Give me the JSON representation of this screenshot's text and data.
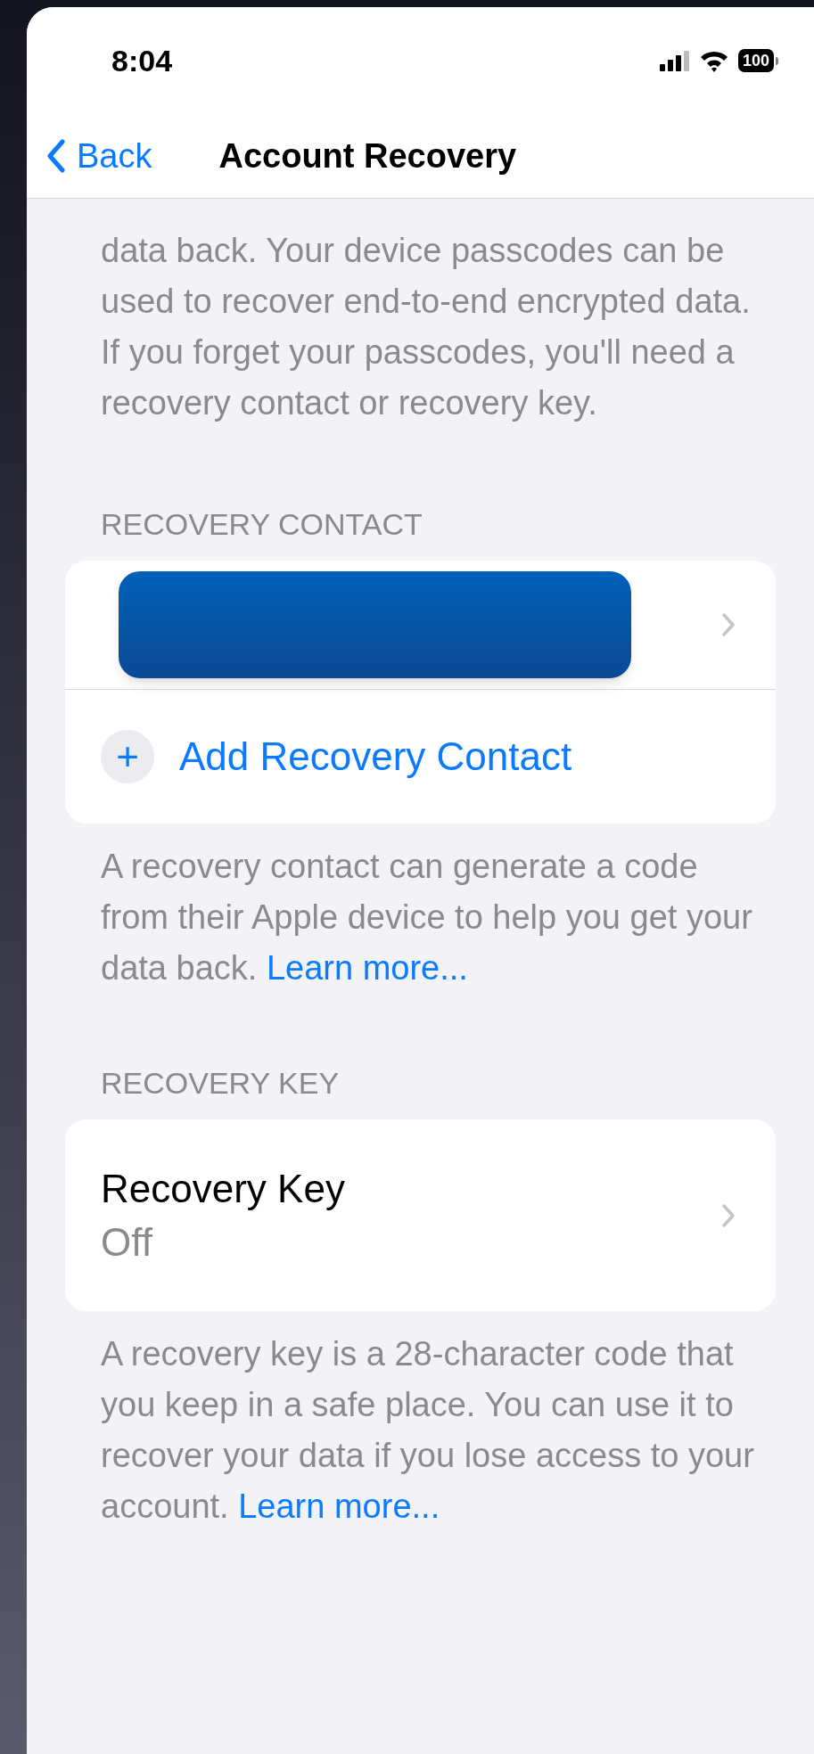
{
  "status_bar": {
    "time": "8:04",
    "battery": "100"
  },
  "nav": {
    "back": "Back",
    "title": "Account Recovery"
  },
  "intro": "data back. Your device passcodes can be used to recover end-to-end encrypted data. If you forget your passcodes, you'll need a recovery contact or recovery key.",
  "sections": [
    {
      "header": "RECOVERY CONTACT",
      "rows": [
        {
          "kind": "redacted"
        },
        {
          "kind": "add",
          "icon": "+",
          "label": "Add Recovery Contact"
        }
      ],
      "footer": "A recovery contact can generate a code from their Apple device to help you get your data back.",
      "link": "Learn more..."
    },
    {
      "header": "RECOVERY KEY",
      "rows": [
        {
          "kind": "detail",
          "label": "Recovery Key",
          "value": "Off"
        }
      ],
      "footer": "A recovery key is a 28-character code that you keep in a safe place. You can use it to recover your data if you lose access to your account.",
      "link": "Learn more..."
    }
  ]
}
